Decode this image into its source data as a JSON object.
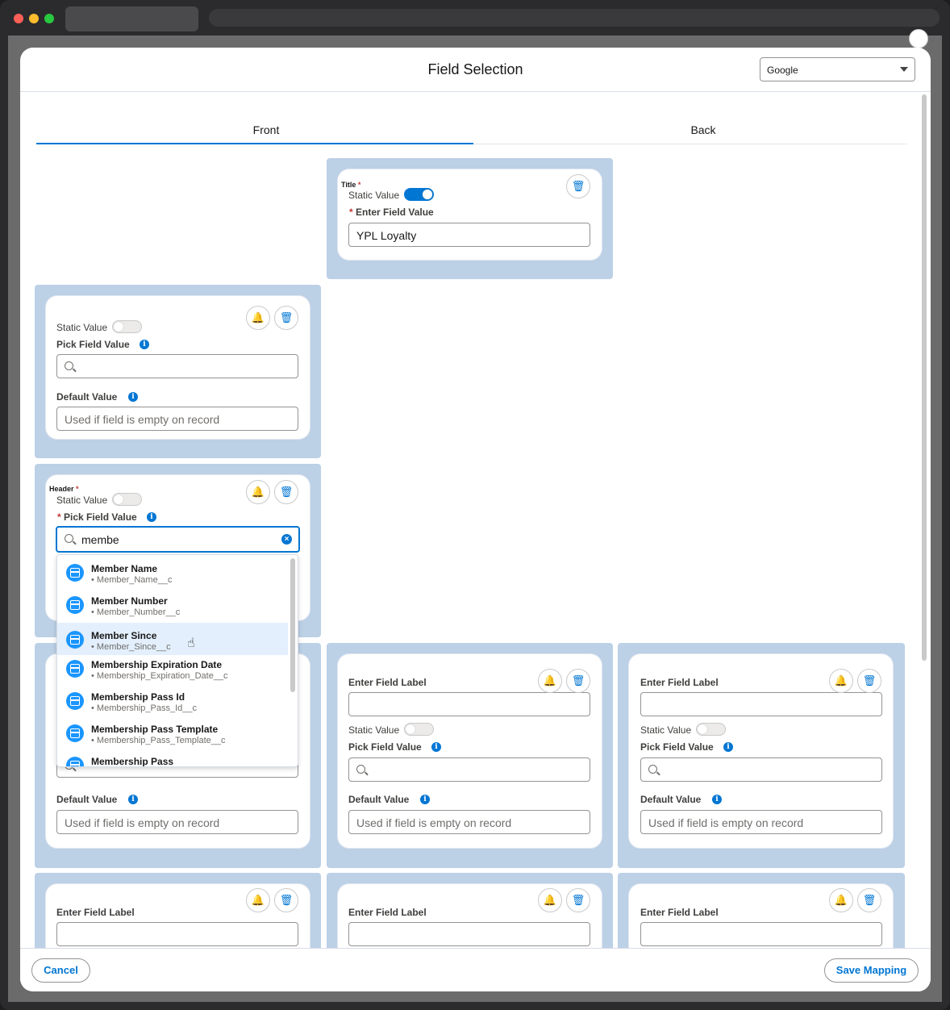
{
  "modal": {
    "title": "Field Selection",
    "template_select": "Google"
  },
  "tabs": {
    "front": "Front",
    "back": "Back"
  },
  "common": {
    "static_value": "Static Value",
    "pick_field_value": "Pick Field Value",
    "default_value": "Default Value",
    "enter_field_label": "Enter Field Label",
    "enter_field_value": "Enter Field Value",
    "default_placeholder": "Used if field is empty on record",
    "required_mark": "*",
    "info_glyph": "i",
    "bell_glyph": "🔔",
    "trash_glyph": "🗑"
  },
  "title_card": {
    "label": "Title",
    "static_on": true,
    "value": "YPL Loyalty"
  },
  "header_card": {
    "label": "Header",
    "search_value": "membe"
  },
  "dropdown": {
    "items": [
      {
        "title": "Member Name",
        "api": "• Member_Name__c"
      },
      {
        "title": "Member Number",
        "api": "• Member_Number__c"
      },
      {
        "title": "Member Since",
        "api": "• Member_Since__c"
      },
      {
        "title": "Membership Expiration Date",
        "api": "• Membership_Expiration_Date__c"
      },
      {
        "title": "Membership Pass Id",
        "api": "• Membership_Pass_Id__c"
      },
      {
        "title": "Membership Pass Template",
        "api": "• Membership_Pass_Template__c"
      },
      {
        "title": "Membership Pass",
        "api": ""
      }
    ],
    "highlighted_index": 2
  },
  "footer": {
    "cancel": "Cancel",
    "save": "Save Mapping"
  },
  "colors": {
    "accent": "#0176d3",
    "slot": "#bcd0e6"
  },
  "icons": [
    "search-icon",
    "bell-icon",
    "trash-icon",
    "info-icon",
    "clear-icon",
    "pointer-cursor-icon",
    "field-icon"
  ]
}
